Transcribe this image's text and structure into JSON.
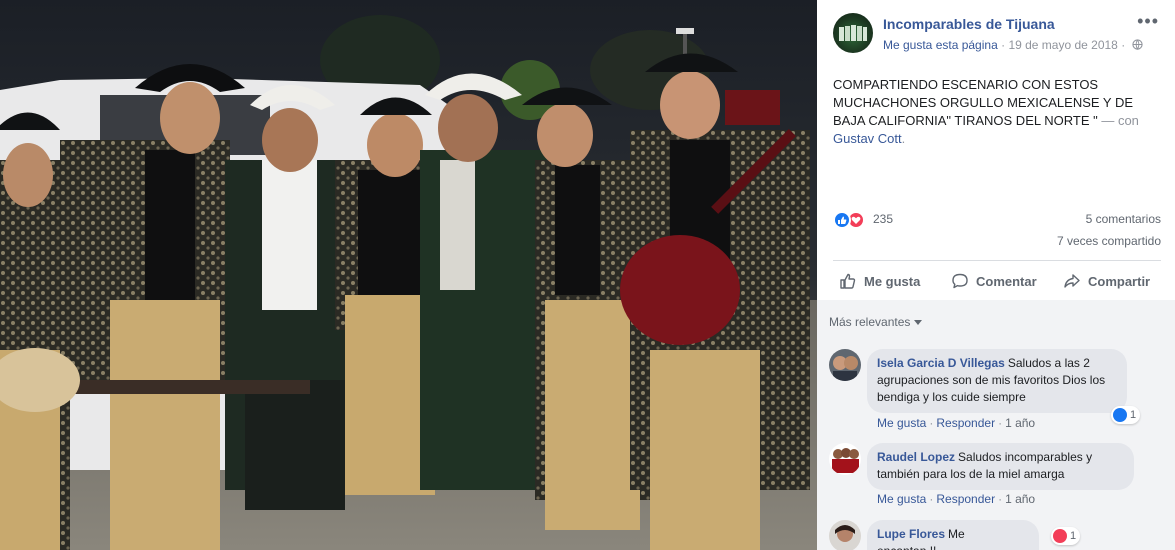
{
  "photo": {
    "description_icon": "band-group-photo",
    "bg_color": "#1a1e24"
  },
  "post": {
    "page_name": "Incomparables de Tijuana",
    "meta_like": "Me gusta esta página",
    "meta_sep": "·",
    "date": "19 de mayo de 2018",
    "meta_sep2": "·",
    "more": "•••",
    "text_main": "COMPARTIENDO ESCENARIO CON ESTOS MUCHACHONES ORGULLO MEXICALENSE Y DE BAJA CALIFORNIA\" TIRANOS DEL NORTE \"",
    "text_dash": " — con ",
    "text_tag": "Gustav Cott",
    "text_end": ".",
    "reaction_count": "235",
    "comments_count": "5 comentarios",
    "shares_count": "7 veces compartido"
  },
  "actions": {
    "like": "Me gusta",
    "comment": "Comentar",
    "share": "Compartir"
  },
  "comments_section": {
    "sort_label": "Más relevantes",
    "comments": [
      {
        "author": "Isela Garcia D Villegas",
        "text": "Saludos a las 2 agrupaciones son de mis favoritos Dios los bendiga y los cuide siempre",
        "like": "Me gusta",
        "reply": "Responder",
        "time": "1 año",
        "reaction_count": "1"
      },
      {
        "author": "Raudel Lopez",
        "text": "Saludos incomparables y también para los de la miel amarga",
        "like": "Me gusta",
        "reply": "Responder",
        "time": "1 año"
      },
      {
        "author": "Lupe Flores",
        "text": "Me encantan !!",
        "reaction_count": "1"
      }
    ]
  },
  "colors": {
    "link": "#385898",
    "like_blue": "#1877f2",
    "love_red": "#f33e58",
    "bubble": "#e4e6eb",
    "comments_bg": "#f2f3f5"
  }
}
